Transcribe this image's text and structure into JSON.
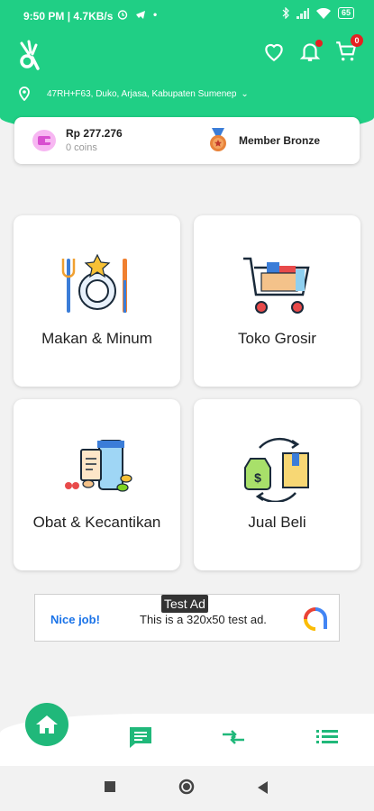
{
  "status_bar": {
    "time": "9:50 PM",
    "speed": "4.7KB/s",
    "battery": "65"
  },
  "header": {
    "location": "47RH+F63, Duko, Arjasa, Kabupaten Sumenep",
    "cart_count": "0",
    "accent_color": "#20cf85"
  },
  "member": {
    "balance": "Rp 277.276",
    "coins": "0 coins",
    "level": "Member Bronze"
  },
  "categories": [
    {
      "label": "Makan & Minum",
      "icon": "food-drink-icon"
    },
    {
      "label": "Toko Grosir",
      "icon": "grocery-cart-icon"
    },
    {
      "label": "Obat & Kecantikan",
      "icon": "medicine-beauty-icon"
    },
    {
      "label": "Jual Beli",
      "icon": "buy-sell-icon"
    }
  ],
  "ad": {
    "tag": "Test Ad",
    "headline": "Nice job!",
    "text": "This is a 320x50 test ad."
  },
  "bottom_nav": [
    "home-icon",
    "chat-icon",
    "transactions-icon",
    "menu-list-icon"
  ]
}
